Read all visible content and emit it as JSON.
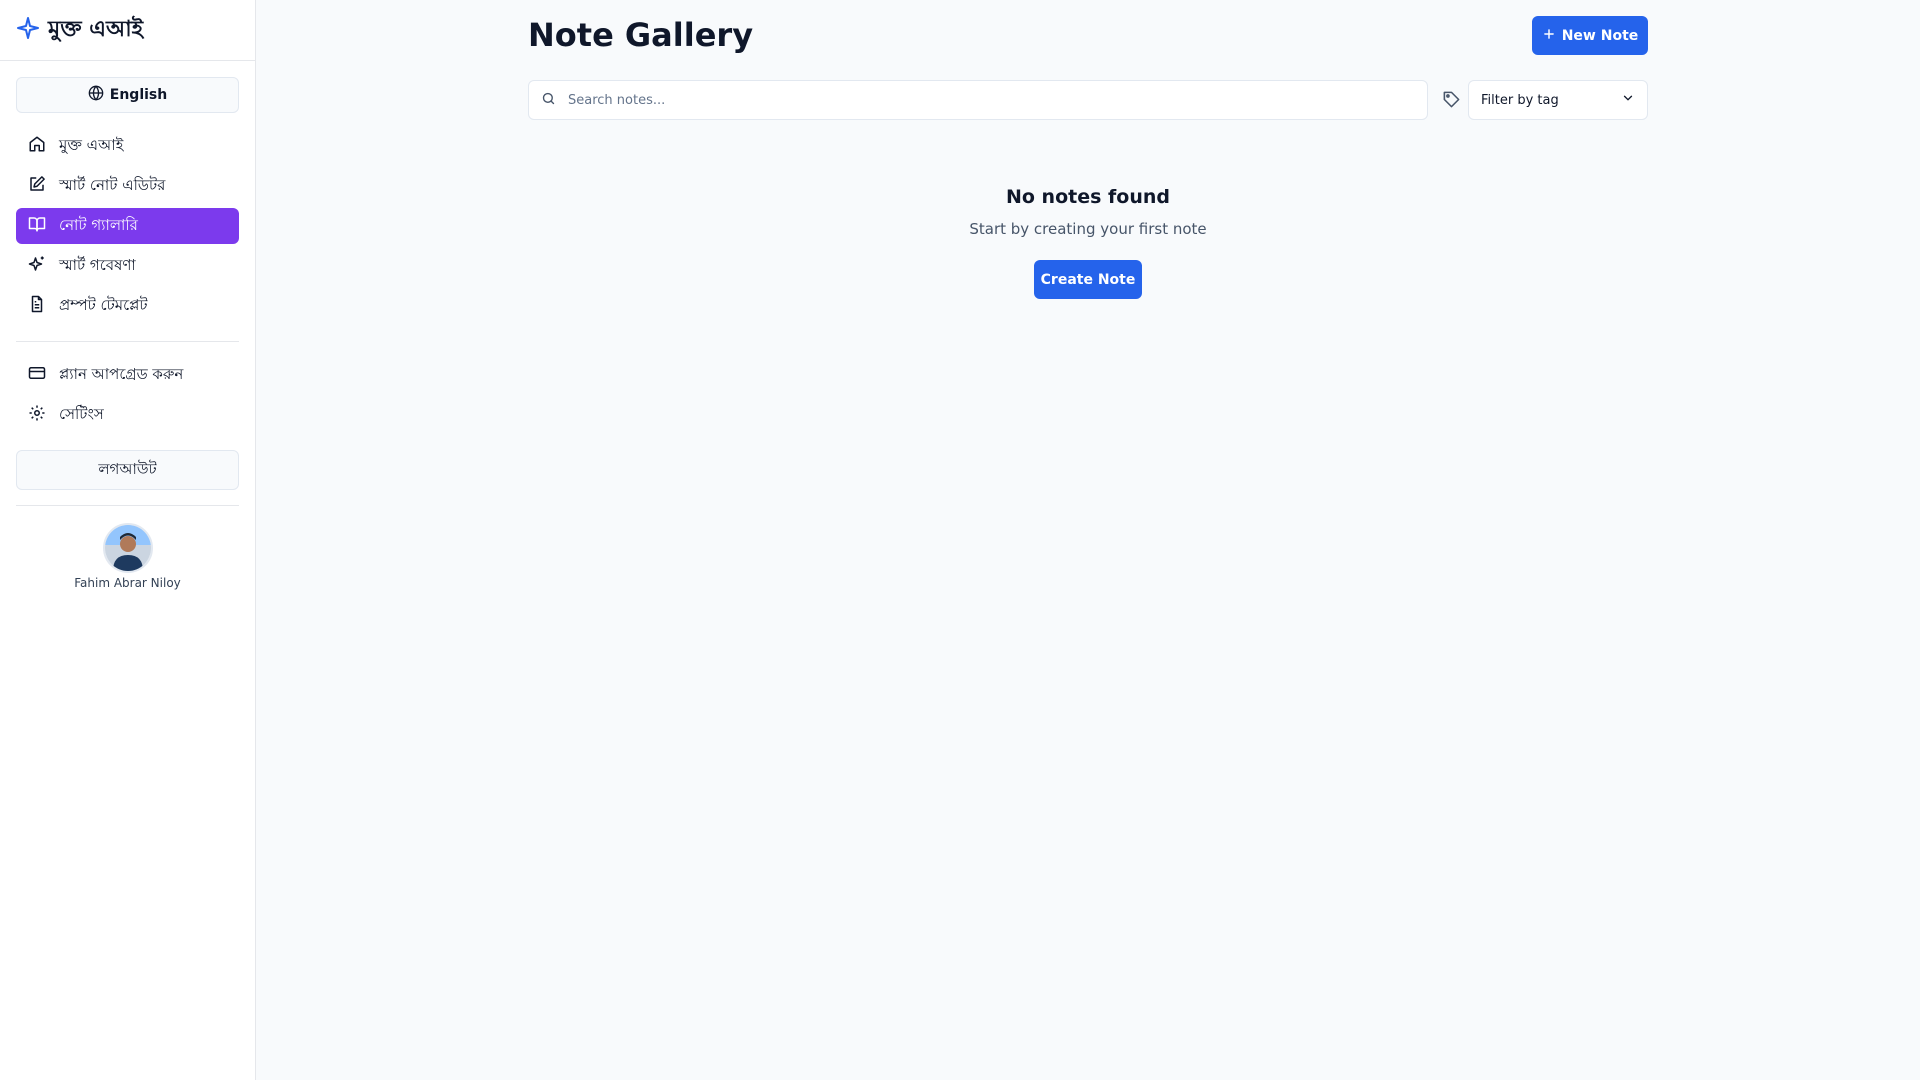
{
  "sidebar": {
    "logo_text": "মুক্ত এআই",
    "language_label": "English",
    "nav_main": [
      {
        "label": "মুক্ত এআই",
        "icon": "home-icon",
        "active": false
      },
      {
        "label": "স্মার্ট নোট এডিটর",
        "icon": "edit-icon",
        "active": false
      },
      {
        "label": "নোট গ্যালারি",
        "icon": "book-open-icon",
        "active": true
      },
      {
        "label": "স্মার্ট গবেষণা",
        "icon": "sparkles-icon",
        "active": false
      },
      {
        "label": "প্রম্পট টেমপ্লেট",
        "icon": "file-text-icon",
        "active": false
      }
    ],
    "nav_secondary": [
      {
        "label": "প্ল্যান আপগ্রেড করুন",
        "icon": "credit-card-icon"
      },
      {
        "label": "সেটিংস",
        "icon": "settings-icon"
      }
    ],
    "logout_label": "লগআউট",
    "user_name": "Fahim Abrar Niloy"
  },
  "main": {
    "title": "Note Gallery",
    "new_note_label": "New Note",
    "search_placeholder": "Search notes...",
    "filter_label": "Filter by tag",
    "empty_title": "No notes found",
    "empty_subtitle": "Start by creating your first note",
    "create_label": "Create Note"
  },
  "colors": {
    "accent": "#2563eb",
    "active_nav": "#7c3aed",
    "background": "#f8fafc"
  }
}
